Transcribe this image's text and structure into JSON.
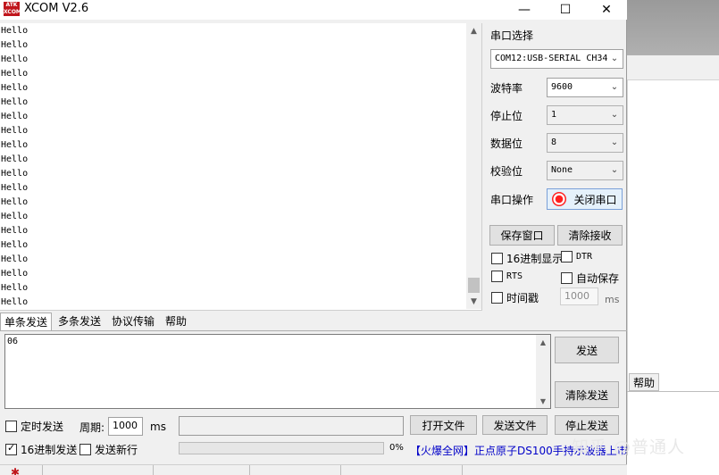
{
  "window": {
    "title": "XCOM V2.6",
    "logo": "ATK\nXCOM",
    "min": "—",
    "max": "☐",
    "close": "✕"
  },
  "receive": {
    "lines": "Hello\nHello\nHello\nHello\nHello\nHello\nHello\nHello\nHello\nHello\nHello\nHello\nHello\nHello\nHello\nHello\nHello\nHello\nHello\nHello"
  },
  "panel": {
    "port_label": "串口选择",
    "port_value": "COM12:USB-SERIAL CH34",
    "baud_label": "波特率",
    "baud_value": "9600",
    "stop_label": "停止位",
    "stop_value": "1",
    "data_label": "数据位",
    "data_value": "8",
    "parity_label": "校验位",
    "parity_value": "None",
    "op_label": "串口操作",
    "open_close_label": "关闭串口",
    "save_window": "保存窗口",
    "clear_recv": "清除接收",
    "hex_display": "16进制显示",
    "dtr": "DTR",
    "rts": "RTS",
    "auto_save": "自动保存",
    "timestamp": "时间戳",
    "ts_value": "1000",
    "ms": "ms"
  },
  "tabs": [
    "单条发送",
    "多条发送",
    "协议传输",
    "帮助"
  ],
  "send": {
    "text": "06",
    "send_btn": "发送",
    "clear_send": "清除发送",
    "timed_send": "定时发送",
    "period_label": "周期:",
    "period_value": "1000",
    "ms": "ms",
    "open_file": "打开文件",
    "send_file": "发送文件",
    "stop_send": "停止发送",
    "hex_send": "16进制发送",
    "new_line": "发送新行",
    "percent": "0%",
    "ad_text": "【火爆全网】正点原子DS100手持示波器上市"
  },
  "background": {
    "tab": "帮助",
    "watermark": "知乎 @普通人"
  },
  "colors": {
    "accent": "#c0161c",
    "link": "#0000c8",
    "led": "#ff1f1f"
  }
}
